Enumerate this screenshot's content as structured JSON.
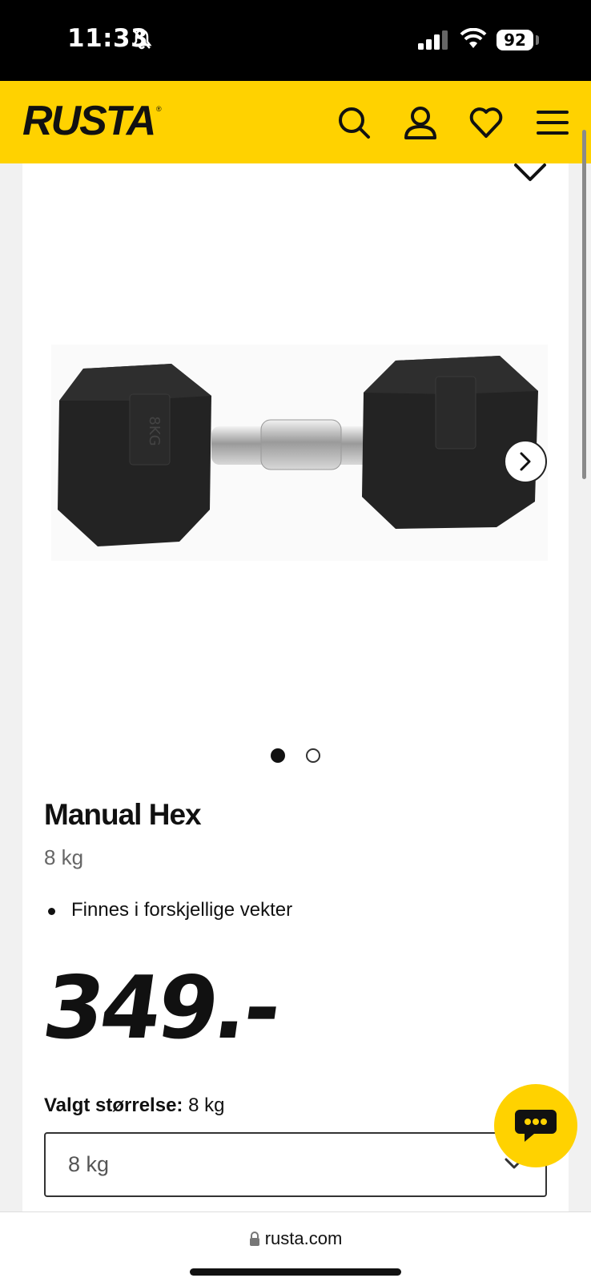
{
  "status_bar": {
    "time": "11:33",
    "battery": "92",
    "icons": [
      "bell-slash-icon",
      "signal-icon",
      "wifi-icon",
      "battery-icon"
    ]
  },
  "header": {
    "logo": "RUSTA",
    "background_color": "#ffd200",
    "icons": [
      "search-icon",
      "account-icon",
      "heart-icon",
      "menu-icon"
    ]
  },
  "product": {
    "gallery": {
      "dots": 2,
      "active_index": 0,
      "image": "hex-dumbbell",
      "image_label": "8KG"
    },
    "title": "Manual Hex",
    "variant": "8 kg",
    "features": [
      "Finnes i forskjellige vekter"
    ],
    "price": "349.-"
  },
  "size_selector": {
    "label": "Valgt størrelse:",
    "label_value": "8 kg",
    "selected": "8 kg"
  },
  "browser": {
    "url": "rusta.com"
  }
}
